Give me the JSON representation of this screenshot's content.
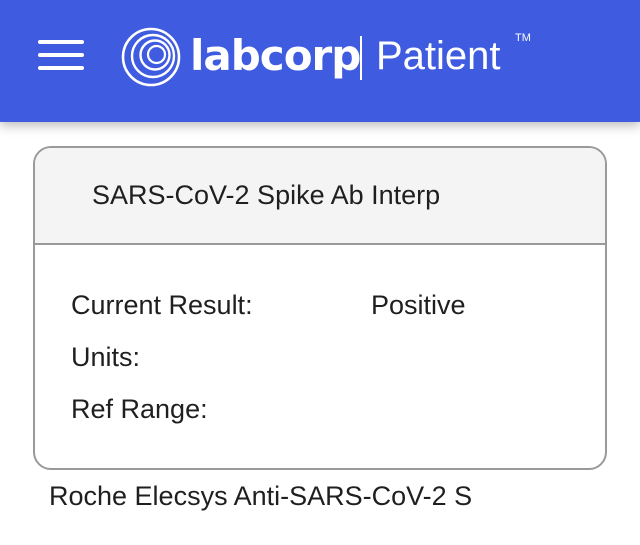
{
  "header": {
    "brand": "labcorp",
    "product": "Patient",
    "trademark": "TM",
    "background_color": "#3f5ce0"
  },
  "card": {
    "title": "SARS-CoV-2 Spike Ab Interp",
    "rows": [
      {
        "label": "Current Result:",
        "value": "Positive"
      },
      {
        "label": "Units:",
        "value": ""
      },
      {
        "label": "Ref Range:",
        "value": ""
      }
    ]
  },
  "footnote": "Roche Elecsys Anti-SARS-CoV-2 S"
}
